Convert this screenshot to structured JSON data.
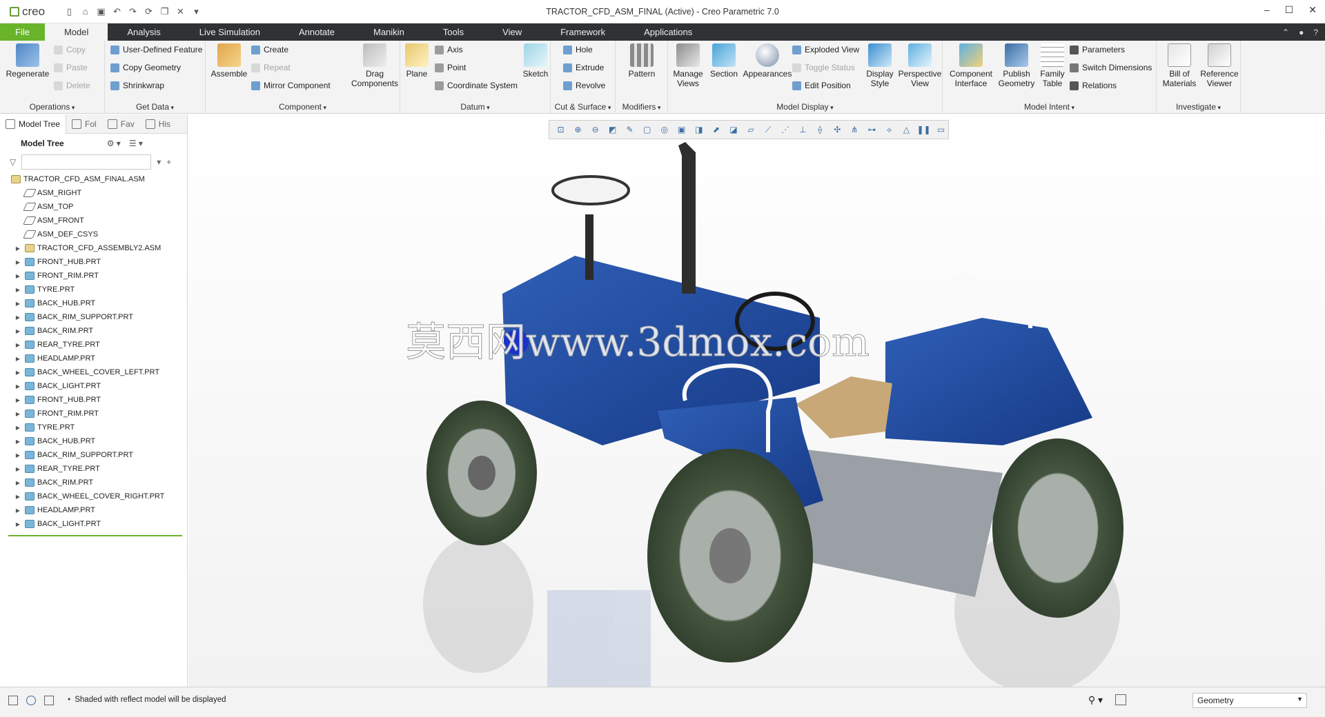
{
  "app": {
    "logo": "creo",
    "title": "TRACTOR_CFD_ASM_FINAL (Active) - Creo Parametric 7.0"
  },
  "menu": {
    "tabs": [
      "File",
      "Model",
      "Analysis",
      "Live Simulation",
      "Annotate",
      "Manikin",
      "Tools",
      "View",
      "Framework",
      "Applications"
    ]
  },
  "ribbon": {
    "operations": {
      "label": "Operations",
      "regenerate": "Regenerate",
      "copy": "Copy",
      "paste": "Paste",
      "delete": "Delete"
    },
    "getdata": {
      "label": "Get Data",
      "udf": "User-Defined Feature",
      "copy_geom": "Copy Geometry",
      "shrinkwrap": "Shrinkwrap"
    },
    "component": {
      "label": "Component",
      "assemble": "Assemble",
      "create": "Create",
      "repeat": "Repeat",
      "mirror": "Mirror Component",
      "drag": "Drag Components"
    },
    "datum": {
      "label": "Datum",
      "plane": "Plane",
      "axis": "Axis",
      "point": "Point",
      "csys": "Coordinate System",
      "sketch": "Sketch"
    },
    "cut": {
      "label": "Cut & Surface",
      "hole": "Hole",
      "extrude": "Extrude",
      "revolve": "Revolve"
    },
    "modifiers": {
      "label": "Modifiers",
      "pattern": "Pattern"
    },
    "display": {
      "label": "Model Display",
      "manage_views": "Manage Views",
      "section": "Section",
      "appearances": "Appearances",
      "exploded": "Exploded View",
      "toggle": "Toggle Status",
      "edit_pos": "Edit Position",
      "display_style": "Display Style",
      "perspective": "Perspective View"
    },
    "intent": {
      "label": "Model Intent",
      "comp_iface": "Component Interface",
      "publish": "Publish Geometry",
      "family": "Family Table",
      "params": "Parameters",
      "switch_dims": "Switch Dimensions",
      "relations": "Relations"
    },
    "investigate": {
      "label": "Investigate",
      "bom": "Bill of Materials",
      "ref_viewer": "Reference Viewer"
    }
  },
  "panel": {
    "tabs": [
      "Model Tree",
      "Fol",
      "Fav",
      "His"
    ],
    "tree_title": "Model Tree",
    "root": "TRACTOR_CFD_ASM_FINAL.ASM",
    "items": [
      {
        "label": "ASM_RIGHT",
        "type": "datum",
        "expand": false
      },
      {
        "label": "ASM_TOP",
        "type": "datum",
        "expand": false
      },
      {
        "label": "ASM_FRONT",
        "type": "datum",
        "expand": false
      },
      {
        "label": "ASM_DEF_CSYS",
        "type": "datum",
        "expand": false
      },
      {
        "label": "TRACTOR_CFD_ASSEMBLY2.ASM",
        "type": "asm",
        "expand": true
      },
      {
        "label": "FRONT_HUB.PRT",
        "type": "prt",
        "expand": true
      },
      {
        "label": "FRONT_RIM.PRT",
        "type": "prt",
        "expand": true
      },
      {
        "label": "TYRE.PRT",
        "type": "prt",
        "expand": true
      },
      {
        "label": "BACK_HUB.PRT",
        "type": "prt",
        "expand": true
      },
      {
        "label": "BACK_RIM_SUPPORT.PRT",
        "type": "prt",
        "expand": true
      },
      {
        "label": "BACK_RIM.PRT",
        "type": "prt",
        "expand": true
      },
      {
        "label": "REAR_TYRE.PRT",
        "type": "prt",
        "expand": true
      },
      {
        "label": "HEADLAMP.PRT",
        "type": "prt",
        "expand": true
      },
      {
        "label": "BACK_WHEEL_COVER_LEFT.PRT",
        "type": "prt",
        "expand": true
      },
      {
        "label": "BACK_LIGHT.PRT",
        "type": "prt",
        "expand": true
      },
      {
        "label": "FRONT_HUB.PRT",
        "type": "prt",
        "expand": true
      },
      {
        "label": "FRONT_RIM.PRT",
        "type": "prt",
        "expand": true
      },
      {
        "label": "TYRE.PRT",
        "type": "prt",
        "expand": true
      },
      {
        "label": "BACK_HUB.PRT",
        "type": "prt",
        "expand": true
      },
      {
        "label": "BACK_RIM_SUPPORT.PRT",
        "type": "prt",
        "expand": true
      },
      {
        "label": "REAR_TYRE.PRT",
        "type": "prt",
        "expand": true
      },
      {
        "label": "BACK_RIM.PRT",
        "type": "prt",
        "expand": true
      },
      {
        "label": "BACK_WHEEL_COVER_RIGHT.PRT",
        "type": "prt",
        "expand": true
      },
      {
        "label": "HEADLAMP.PRT",
        "type": "prt",
        "expand": true
      },
      {
        "label": "BACK_LIGHT.PRT",
        "type": "prt",
        "expand": true
      }
    ]
  },
  "viewport": {
    "watermark": "莫西网www.3dmox.com"
  },
  "status": {
    "message": "Shaded with reflect model will be displayed",
    "filter": "Geometry"
  }
}
